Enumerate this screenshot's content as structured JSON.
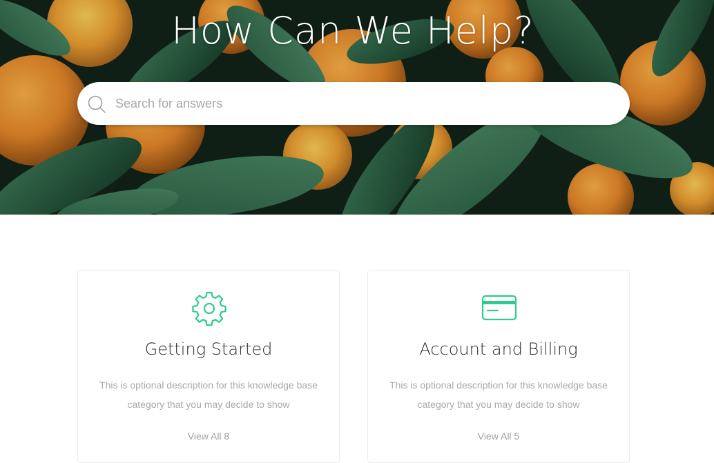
{
  "hero": {
    "title": "How Can We Help?",
    "search": {
      "placeholder": "Search for answers",
      "value": ""
    }
  },
  "accent_color": "#2ecc8a",
  "categories": [
    {
      "icon": "gear-icon",
      "title": "Getting Started",
      "description": "This is optional description for this knowledge base category that you may decide to show",
      "link_label": "View All 8"
    },
    {
      "icon": "credit-card-icon",
      "title": "Account and Billing",
      "description": "This is optional description for this knowledge base category that you may decide to show",
      "link_label": "View All 5"
    }
  ]
}
